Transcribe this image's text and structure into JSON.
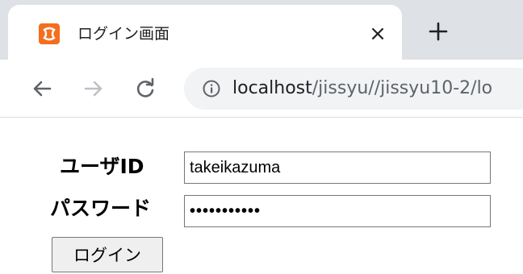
{
  "tab": {
    "title": "ログイン画面",
    "favicon": "xampp-icon",
    "close_symbol": "×"
  },
  "toolbar": {
    "url_host": "localhost",
    "url_path": "/jissyu//jissyu10-2/lo"
  },
  "form": {
    "userid_label": "ユーザID",
    "userid_value": "takeikazuma",
    "password_label": "パスワード",
    "password_masked": "•••••••••••",
    "login_button": "ログイン"
  },
  "colors": {
    "tabstrip_bg": "#dee1e6",
    "favicon_bg": "#f46e1f",
    "omnibox_bg": "#f1f3f4",
    "button_bg": "#efefef"
  }
}
